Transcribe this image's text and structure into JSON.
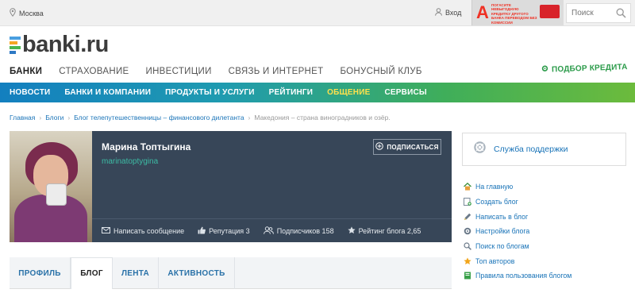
{
  "topbar": {
    "location": "Москва",
    "login": "Вход",
    "ad_text": "ПОГАСИТЕ НЕВЫГОДНУЮ КРЕДИТКУ ДРУГОГО БАНКА ПЕРЕВОДОМ БЕЗ КОМИССИИ",
    "search_placeholder": "Поиск"
  },
  "logo": {
    "text": "banki.ru"
  },
  "main_nav": [
    {
      "label": "БАНКИ",
      "active": true
    },
    {
      "label": "СТРАХОВАНИЕ"
    },
    {
      "label": "ИНВЕСТИЦИИ"
    },
    {
      "label": "СВЯЗЬ И ИНТЕРНЕТ"
    },
    {
      "label": "БОНУСНЫЙ КЛУБ"
    }
  ],
  "credit_link": "ПОДБОР КРЕДИТА",
  "sub_nav": [
    {
      "label": "НОВОСТИ"
    },
    {
      "label": "БАНКИ И КОМПАНИИ"
    },
    {
      "label": "ПРОДУКТЫ И УСЛУГИ"
    },
    {
      "label": "РЕЙТИНГИ"
    },
    {
      "label": "ОБЩЕНИЕ",
      "highlight": true
    },
    {
      "label": "СЕРВИСЫ"
    }
  ],
  "breadcrumbs": [
    "Главная",
    "Блоги",
    "Блог телепутешественницы – финансового дилетанта",
    "Македония – страна виноградников и озёр."
  ],
  "profile": {
    "name": "Марина Топтыгина",
    "login": "marinatoptygina",
    "subscribe_label": "ПОДПИСАТЬСЯ",
    "write_message": "Написать сообщение",
    "reputation": "Репутация 3",
    "subscribers": "Подписчиков 158",
    "blog_rating": "Рейтинг блога 2,65"
  },
  "tabs": [
    {
      "label": "ПРОФИЛЬ"
    },
    {
      "label": "БЛОГ",
      "active": true
    },
    {
      "label": "ЛЕНТА"
    },
    {
      "label": "АКТИВНОСТЬ"
    }
  ],
  "sidebar": {
    "support": "Служба поддержки",
    "links": [
      {
        "label": "На главную",
        "icon": "home-icon"
      },
      {
        "label": "Создать блог",
        "icon": "create-blog-icon"
      },
      {
        "label": "Написать в блог",
        "icon": "pencil-icon"
      },
      {
        "label": "Настройки блога",
        "icon": "settings-icon"
      },
      {
        "label": "Поиск по блогам",
        "icon": "search-icon"
      },
      {
        "label": "Топ авторов",
        "icon": "star-icon"
      },
      {
        "label": "Правила пользования блогом",
        "icon": "rules-book-icon"
      }
    ]
  },
  "colors": {
    "accent_blue": "#1a74b8",
    "profile_bg": "#374658",
    "login_green": "#3dbba4",
    "credit_green": "#2b9b4a",
    "highlight_yellow": "#ffe14d",
    "alfa_red": "#ef3124"
  }
}
